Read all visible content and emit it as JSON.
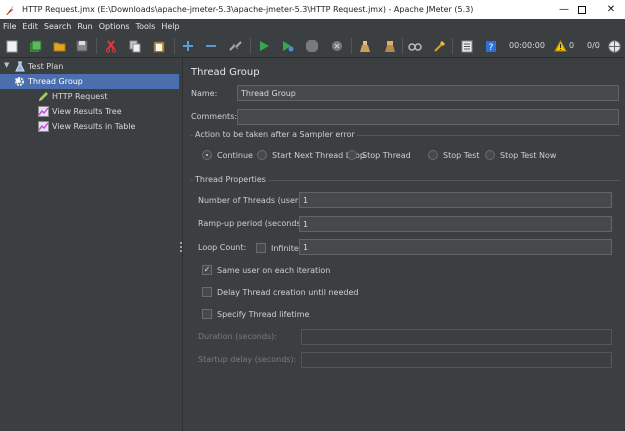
{
  "window": {
    "title": "HTTP Request.jmx (E:\\Downloads\\apache-jmeter-5.3\\apache-jmeter-5.3\\HTTP Request.jmx) - Apache JMeter (5.3)"
  },
  "menu": [
    "File",
    "Edit",
    "Search",
    "Run",
    "Options",
    "Tools",
    "Help"
  ],
  "toolbar": {
    "elapsed": "00:00:00",
    "warnings": "0",
    "threads": "0/0"
  },
  "tree": {
    "test_plan": "Test Plan",
    "thread_group": "Thread Group",
    "http_request": "HTTP Request",
    "view_results_tree": "View Results Tree",
    "view_results_table": "View Results in Table"
  },
  "panel": {
    "heading": "Thread Group",
    "name_label": "Name:",
    "name_value": "Thread Group",
    "comments_label": "Comments:",
    "comments_value": "",
    "error_action_legend": "Action to be taken after a Sampler error",
    "error_actions": [
      "Continue",
      "Start Next Thread Loop",
      "Stop Thread",
      "Stop Test",
      "Stop Test Now"
    ],
    "error_action_selected": "Continue",
    "thread_props_legend": "Thread Properties",
    "threads_label": "Number of Threads (users):",
    "threads_value": "1",
    "rampup_label": "Ramp-up period (seconds):",
    "rampup_value": "1",
    "loop_label": "Loop Count:",
    "infinite_label": "Infinite",
    "loop_value": "1",
    "same_user_label": "Same user on each iteration",
    "same_user_checked": true,
    "delay_label": "Delay Thread creation until needed",
    "lifetime_label": "Specify Thread lifetime",
    "duration_label": "Duration (seconds):",
    "duration_value": "",
    "startup_label": "Startup delay (seconds):",
    "startup_value": ""
  }
}
